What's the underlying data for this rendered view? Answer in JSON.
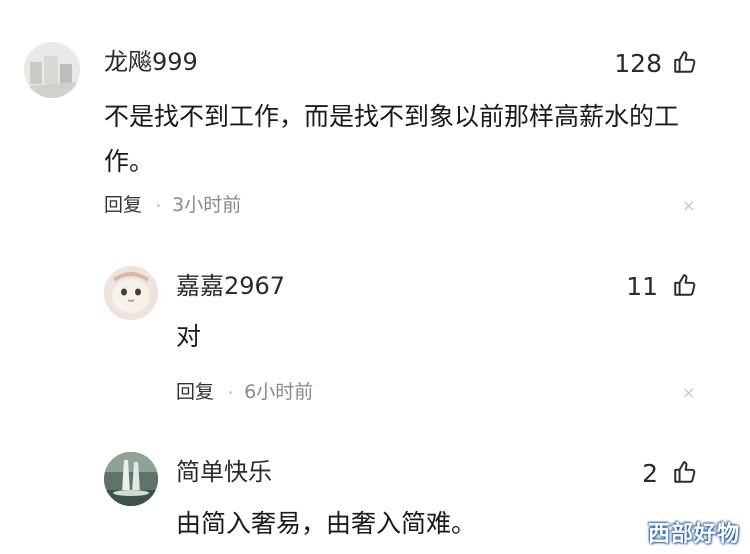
{
  "comments": [
    {
      "username": "龙飚999",
      "likes": "128",
      "text": "不是找不到工作，而是找不到象以前那样高薪水的工作。",
      "reply_label": "回复",
      "separator": "·",
      "time": "3小时前",
      "close": "×",
      "icon": "thumbs-up-icon"
    },
    {
      "username": "嘉嘉2967",
      "likes": "11",
      "text": "对",
      "reply_label": "回复",
      "separator": "·",
      "time": "6小时前",
      "close": "×",
      "icon": "thumbs-up-icon"
    },
    {
      "username": "简单快乐",
      "likes": "2",
      "text": "由简入奢易，由奢入简难。",
      "icon": "thumbs-up-icon"
    }
  ],
  "watermark": "西部好物"
}
